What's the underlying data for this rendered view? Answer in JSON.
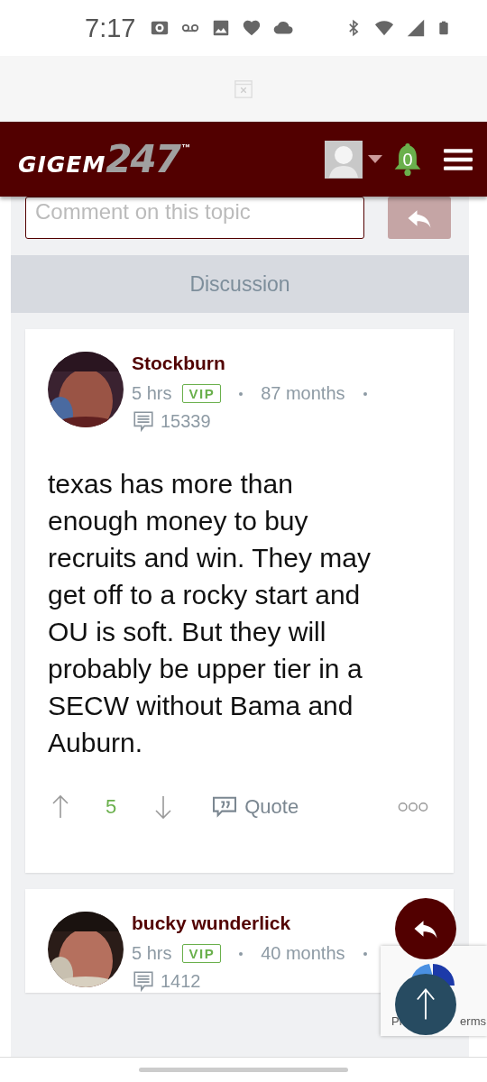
{
  "status_bar": {
    "time": "7:17"
  },
  "header": {
    "logo": {
      "word": "GIGEM",
      "number": "247",
      "mark": "™"
    },
    "notifications": "0"
  },
  "comment": {
    "placeholder": "Comment on this topic"
  },
  "section": {
    "title": "Discussion"
  },
  "posts": [
    {
      "author": "Stockburn",
      "age": "5 hrs",
      "badge": "VIP",
      "tenure": "87 months",
      "post_count": "15339",
      "body": "texas has more than enough money to buy recruits and win. They may get off to a rocky start and OU is soft. But they will probably be upper tier in a SECW without Bama and Auburn.",
      "votes": "5",
      "quote": "Quote"
    },
    {
      "author": "bucky wunderlick",
      "age": "5 hrs",
      "badge": "VIP",
      "tenure": "40 months",
      "post_count": "1412"
    }
  ],
  "recaptcha": {
    "left_text": "Pr",
    "right_text": "erms"
  }
}
